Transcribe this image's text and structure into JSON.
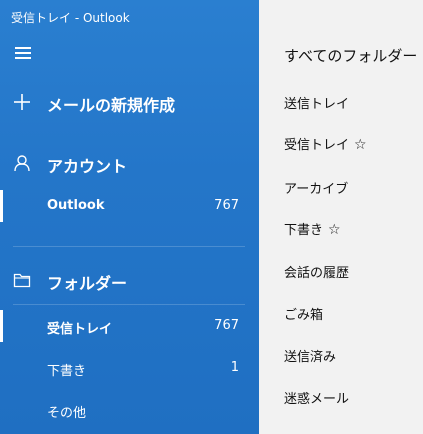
{
  "window": {
    "title": "受信トレイ - Outlook"
  },
  "sidebar": {
    "menu_icon": "hamburger-icon",
    "new_mail": {
      "icon": "plus-icon",
      "label": "メールの新規作成"
    },
    "accounts": {
      "icon": "person-icon",
      "label": "アカウント",
      "items": [
        {
          "label": "Outlook",
          "count": "767",
          "selected": true
        }
      ]
    },
    "folders": {
      "icon": "folder-icon",
      "label": "フォルダー",
      "items": [
        {
          "label": "受信トレイ",
          "count": "767",
          "selected": true
        },
        {
          "label": "下書き",
          "count": "1",
          "selected": false
        },
        {
          "label": "その他",
          "count": "",
          "selected": false
        }
      ]
    }
  },
  "folder_pane": {
    "title": "すべてのフォルダー",
    "items": [
      {
        "label": "送信トレイ",
        "favorite": false
      },
      {
        "label": "受信トレイ",
        "favorite": true,
        "star": "☆"
      },
      {
        "label": "アーカイブ",
        "favorite": false
      },
      {
        "label": "下書き",
        "favorite": true,
        "star": "☆"
      },
      {
        "label": "会話の履歴",
        "favorite": false
      },
      {
        "label": "ごみ箱",
        "favorite": false
      },
      {
        "label": "送信済み",
        "favorite": false
      },
      {
        "label": "迷惑メール",
        "favorite": false
      }
    ]
  },
  "colors": {
    "sidebar_blue": "#2476c9",
    "folder_pane_bg": "#f2f2f2",
    "text_light": "#ffffff",
    "text_dark": "#111111"
  }
}
